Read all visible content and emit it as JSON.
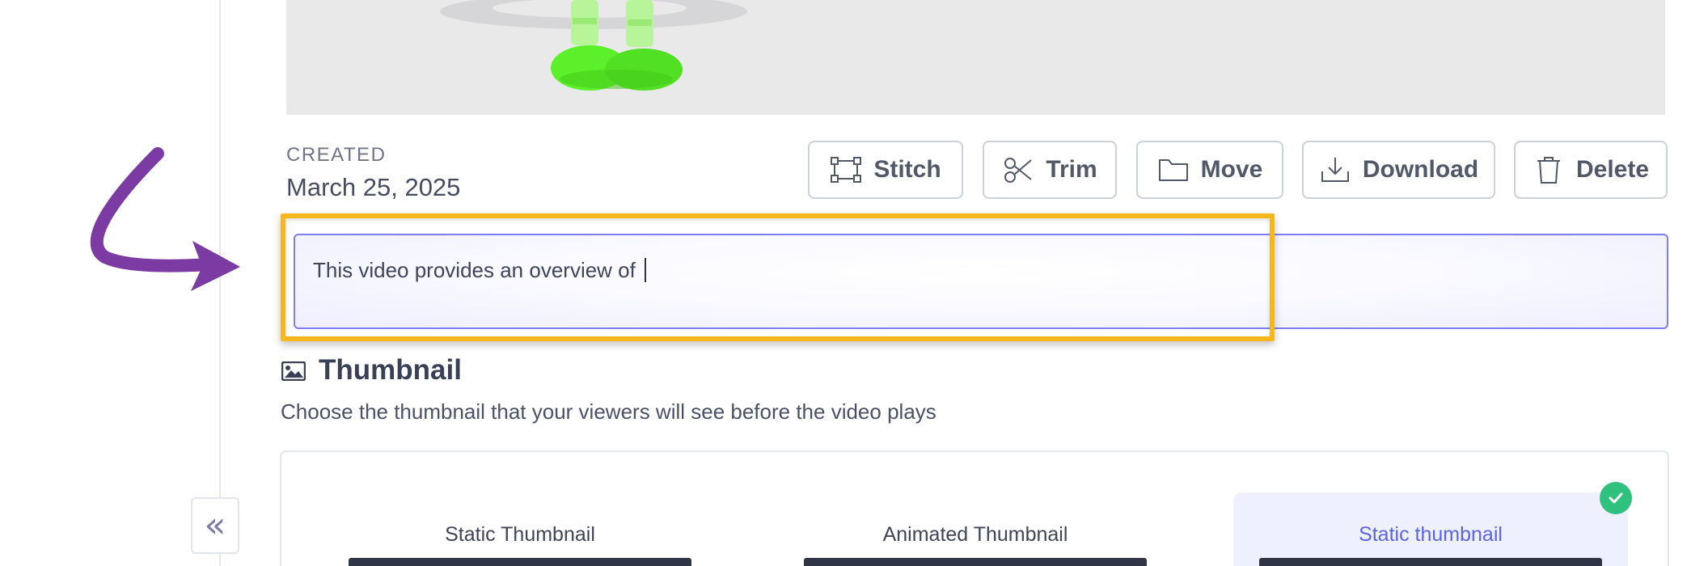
{
  "created": {
    "label": "CREATED",
    "date": "March 25, 2025"
  },
  "actions": [
    {
      "label": "Stitch",
      "icon": "stitch-icon"
    },
    {
      "label": "Trim",
      "icon": "scissors-icon"
    },
    {
      "label": "Move",
      "icon": "folder-icon"
    },
    {
      "label": "Download",
      "icon": "download-icon"
    },
    {
      "label": "Delete",
      "icon": "trash-icon"
    }
  ],
  "description": {
    "value": "This video provides an overview of "
  },
  "thumbnail": {
    "title": "Thumbnail",
    "subtitle": "Choose the thumbnail that your viewers will see before the video plays",
    "options": [
      {
        "label": "Static Thumbnail",
        "selected": false
      },
      {
        "label": "Animated Thumbnail",
        "selected": false
      },
      {
        "label": "Static thumbnail",
        "selected": true
      }
    ]
  },
  "sidebar": {
    "collapse_glyph": "«"
  },
  "colors": {
    "accent": "#5a64e6",
    "highlight": "#f5b71b",
    "annotation_arrow": "#7b3ba3",
    "check": "#2ec27e",
    "figure_green": "#5cf02a"
  }
}
